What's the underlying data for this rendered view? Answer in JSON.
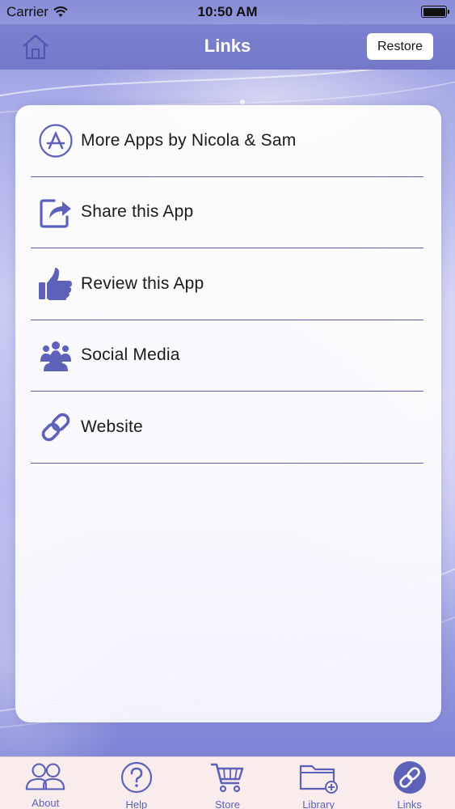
{
  "status_bar": {
    "carrier": "Carrier",
    "time": "10:50 AM"
  },
  "nav": {
    "title": "Links",
    "restore_label": "Restore",
    "home_icon": "home-icon"
  },
  "links": {
    "items": [
      {
        "label": "More Apps by Nicola & Sam",
        "icon": "app-store-icon"
      },
      {
        "label": "Share this App",
        "icon": "share-icon"
      },
      {
        "label": "Review this App",
        "icon": "thumbs-up-icon"
      },
      {
        "label": "Social Media",
        "icon": "people-icon"
      },
      {
        "label": "Website",
        "icon": "link-icon"
      }
    ]
  },
  "tabs": {
    "items": [
      {
        "label": "About",
        "icon": "users-icon"
      },
      {
        "label": "Help",
        "icon": "question-icon"
      },
      {
        "label": "Store",
        "icon": "cart-icon"
      },
      {
        "label": "Library",
        "icon": "folder-add-icon"
      },
      {
        "label": "Links",
        "icon": "link-circle-icon",
        "active": true
      }
    ]
  },
  "colors": {
    "accent": "#5d62b8",
    "nav_bar": "#7378c8",
    "tab_bar": "#f8ecec"
  }
}
